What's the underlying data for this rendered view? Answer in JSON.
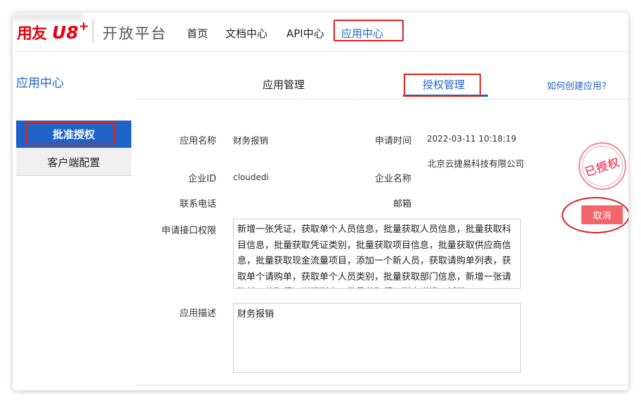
{
  "header": {
    "logo": {
      "brand": "用友",
      "product": "U8",
      "plus": "+"
    },
    "platform_title": "开放平台",
    "nav": {
      "home": "首页",
      "docs": "文档中心",
      "api": "API中心",
      "apps": "应用中心"
    }
  },
  "section_title": "应用中心",
  "tabs": {
    "manage": "应用管理",
    "auth": "授权管理",
    "help_link": "如何创建应用?"
  },
  "sidebar": {
    "items": [
      {
        "label": "批准授权"
      },
      {
        "label": "客户端配置"
      }
    ]
  },
  "form": {
    "app_name_label": "应用名称",
    "app_name_value": "财务报销",
    "apply_time_label": "申请时间",
    "apply_time_value": "2022-03-11 10:18:19",
    "enterprise_id_label": "企业ID",
    "enterprise_id_value": "cloudedi",
    "enterprise_name_label": "企业名称",
    "enterprise_name_value": "北京云捷易科技有限公司",
    "phone_label": "联系电话",
    "email_label": "邮箱",
    "scope_label": "申请接口权限",
    "scope_value": "新增一张凭证，获取单个人员信息，批量获取人员信息，批量获取科目信息，批量获取凭证类别，批量获取项目信息，批量获取供应商信息，批量获取现金流量项目，添加一个新人员，获取请购单列表，获取单个请购单，获取单个人员类别，批量获取部门信息，新增一张请购单，获取凭证详情列表，批量获取凭证列表详情，新增",
    "desc_label": "应用描述",
    "desc_value": "财务报销"
  },
  "stamp_text": "已授权",
  "cancel_label": "取消"
}
